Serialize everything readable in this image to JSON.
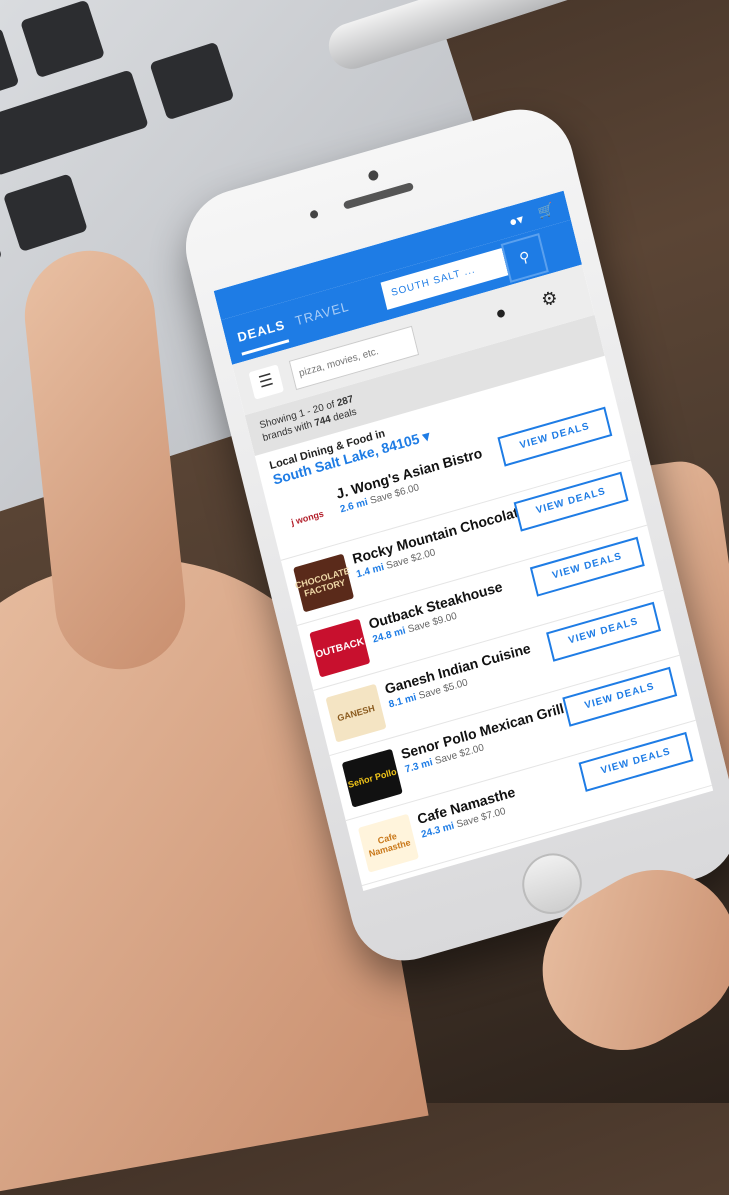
{
  "header": {
    "user_icon": "user-icon",
    "cart_icon": "cart-icon"
  },
  "nav": {
    "tabs": [
      {
        "label": "DEALS"
      },
      {
        "label": "TRAVEL"
      }
    ],
    "location_label": "SOUTH SALT ...",
    "search_icon": "search-icon"
  },
  "search": {
    "placeholder": "pizza, movies, etc."
  },
  "results": {
    "prefix": "Showing 1 - 20 of ",
    "brand_count": "287",
    "mid": "brands with ",
    "deal_count": "744",
    "suffix": " deals"
  },
  "location": {
    "label": "Local Dining & Food in",
    "city": "South Salt Lake, 84105 ▾"
  },
  "restaurants": [
    {
      "name": "J. Wong's Asian Bistro",
      "distance": "2.6 mi",
      "save": "Save $6.00",
      "button": "VIEW DEALS",
      "logo_text": "j wongs"
    },
    {
      "name": "Rocky Mountain Chocolate Factory",
      "distance": "1.4 mi",
      "save": "Save $2.00",
      "button": "VIEW DEALS",
      "logo_text": "CHOCOLATE FACTORY"
    },
    {
      "name": "Outback Steakhouse",
      "distance": "24.8 mi",
      "save": "Save $9.00",
      "button": "VIEW DEALS",
      "logo_text": "OUTBACK"
    },
    {
      "name": "Ganesh Indian Cuisine",
      "distance": "8.1 mi",
      "save": "Save $5.00",
      "button": "VIEW DEALS",
      "logo_text": "GANESH"
    },
    {
      "name": "Senor Pollo Mexican Grill",
      "distance": "7.3 mi",
      "save": "Save $2.00",
      "button": "VIEW DEALS",
      "logo_text": "Señor Pollo"
    },
    {
      "name": "Cafe Namasthe",
      "distance": "24.3 mi",
      "save": "Save $7.00",
      "button": "VIEW DEALS",
      "logo_text": "Cafe Namasthe"
    }
  ]
}
